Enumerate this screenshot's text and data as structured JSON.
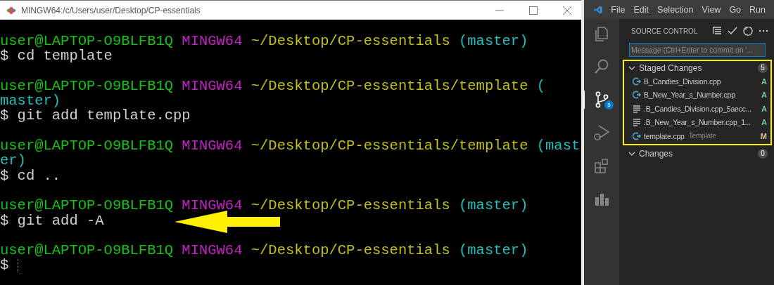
{
  "terminal": {
    "title": "MINGW64:/c/Users/user/Desktop/CP-essentials",
    "lines": [
      {
        "segments": [
          {
            "text": "user@LAPTOP-O9BLFB1Q",
            "kind": "user"
          },
          {
            "text": "MINGW64",
            "kind": "host"
          },
          {
            "text": "~/Desktop/CP-essentials",
            "kind": "path"
          },
          {
            "text": "(master)",
            "kind": "branch"
          }
        ]
      },
      {
        "segments": [
          {
            "text": "$ cd template",
            "kind": "command"
          }
        ]
      },
      {
        "segments": [
          {
            "text": "user@LAPTOP-O9BLFB1Q",
            "kind": "user"
          },
          {
            "text": "MINGW64",
            "kind": "host"
          },
          {
            "text": "~/Desktop/CP-essentials/template",
            "kind": "path"
          },
          {
            "text": "(",
            "kind": "branch"
          }
        ]
      },
      {
        "segments": [
          {
            "text": "master)",
            "kind": "branch"
          }
        ]
      },
      {
        "segments": [
          {
            "text": "$ git add template.cpp",
            "kind": "command"
          }
        ]
      },
      {
        "segments": [
          {
            "text": "user@LAPTOP-O9BLFB1Q",
            "kind": "user"
          },
          {
            "text": "MINGW64",
            "kind": "host"
          },
          {
            "text": "~/Desktop/CP-essentials/template",
            "kind": "path"
          },
          {
            "text": "(mast",
            "kind": "branch"
          }
        ]
      },
      {
        "segments": [
          {
            "text": "er)",
            "kind": "branch"
          }
        ]
      },
      {
        "segments": [
          {
            "text": "$ cd ..",
            "kind": "command"
          }
        ]
      },
      {
        "segments": [
          {
            "text": "user@LAPTOP-O9BLFB1Q",
            "kind": "user"
          },
          {
            "text": "MINGW64",
            "kind": "host"
          },
          {
            "text": "~/Desktop/CP-essentials",
            "kind": "path"
          },
          {
            "text": "(master)",
            "kind": "branch"
          }
        ]
      },
      {
        "segments": [
          {
            "text": "$ git add -A",
            "kind": "command"
          }
        ],
        "arrow": true
      },
      {
        "segments": [
          {
            "text": "user@LAPTOP-O9BLFB1Q",
            "kind": "user"
          },
          {
            "text": "MINGW64",
            "kind": "host"
          },
          {
            "text": "~/Desktop/CP-essentials",
            "kind": "path"
          },
          {
            "text": "(master)",
            "kind": "branch"
          }
        ]
      },
      {
        "segments": [
          {
            "text": "$",
            "kind": "command"
          }
        ],
        "cursor": true
      }
    ]
  },
  "vscode": {
    "menu": [
      "File",
      "Edit",
      "Selection",
      "View",
      "Go",
      "Run"
    ],
    "source_control_badge": "5",
    "panel_title": "SOURCE CONTROL",
    "message": {
      "placeholder": "Message (Ctrl+Enter to commit on '..."
    },
    "groups": [
      {
        "label": "Staged Changes",
        "count": "5",
        "expanded": true,
        "highlighted": true,
        "items": [
          {
            "kind": "cpp",
            "name": "B_Candies_Division.cpp",
            "status": "A",
            "color": "#73c991"
          },
          {
            "kind": "cpp",
            "name": "B_New_Year_s_Number.cpp",
            "status": "A",
            "color": "#73c991"
          },
          {
            "kind": "text",
            "name": ".B_Candies_Division.cpp_5aecc...",
            "status": "A",
            "color": "#73c991"
          },
          {
            "kind": "text",
            "name": ".B_New_Year_s_Number.cpp_1...",
            "status": "A",
            "color": "#73c991"
          },
          {
            "kind": "cpp",
            "name": "template.cpp",
            "description": "Template",
            "status": "M",
            "color": "#e2c08d"
          }
        ]
      },
      {
        "label": "Changes",
        "count": "0",
        "expanded": true,
        "highlighted": false
      }
    ]
  }
}
